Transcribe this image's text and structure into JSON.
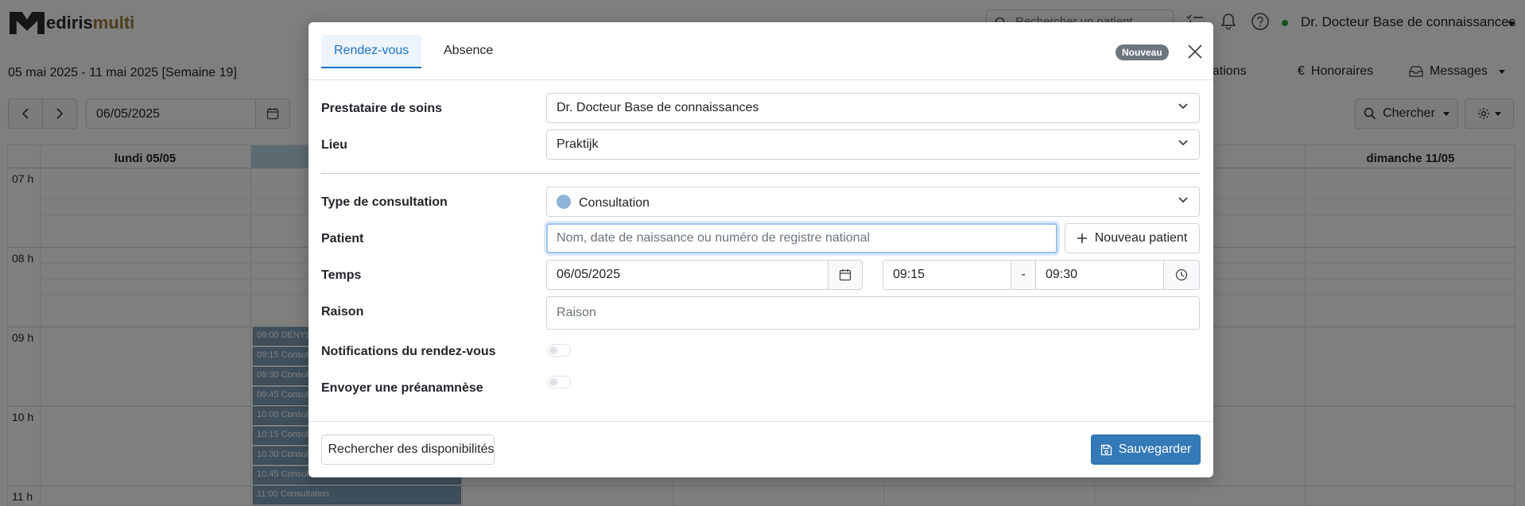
{
  "app": {
    "logo_bold": "ediris",
    "logo_light": "multi",
    "search_placeholder": "Rechercher un patient",
    "user_name": "Dr. Docteur Base de connaissances",
    "week_title": "05 mai 2025 - 11 mai 2025 [Semaine 19]",
    "nav": {
      "consultations": "ultations",
      "honoraires": "Honoraires",
      "messages": "Messages"
    },
    "date_value": "06/05/2025",
    "search_button": "Chercher",
    "calendar": {
      "day_monday": "lundi 05/05",
      "day_saturday_partial": "0/05",
      "day_sunday": "dimanche 11/05",
      "hours": [
        "07 h",
        "08 h",
        "09 h",
        "10 h",
        "11 h"
      ],
      "slots": [
        "09:00 DENYS",
        "09:15 Consultation",
        "09:30 Consultation",
        "09:45 Consultation",
        "10:00 Consultation",
        "10:15 Consultation",
        "10:30 Consultation",
        "10:45 Consultation",
        "11:00 Consultation"
      ]
    }
  },
  "modal": {
    "tabs": [
      "Rendez-vous",
      "Absence"
    ],
    "badge": "Nouveau",
    "fields": {
      "provider": {
        "label": "Prestataire de soins",
        "value": "Dr. Docteur Base de connaissances"
      },
      "location": {
        "label": "Lieu",
        "value": "Praktijk"
      },
      "consult_type": {
        "label": "Type de consultation",
        "value": "Consultation",
        "color": "#8fb4d9"
      },
      "patient": {
        "label": "Patient",
        "placeholder": "Nom, date de naissance ou numéro de registre national",
        "new_button": "Nouveau patient"
      },
      "time": {
        "label": "Temps",
        "date": "06/05/2025",
        "start": "09:15",
        "separator": "-",
        "end": "09:30"
      },
      "reason": {
        "label": "Raison",
        "placeholder": "Raison"
      },
      "notifications": {
        "label": "Notifications du rendez-vous",
        "enabled": false
      },
      "preanamnesis": {
        "label": "Envoyer une préanamnèse",
        "enabled": false
      }
    },
    "footer": {
      "availability_button": "Rechercher des disponibilités",
      "save_button": "Sauvegarder"
    }
  },
  "colors": {
    "accent": "#1a73c8",
    "save_button": "#337ab7",
    "online_status": "#28a745"
  }
}
